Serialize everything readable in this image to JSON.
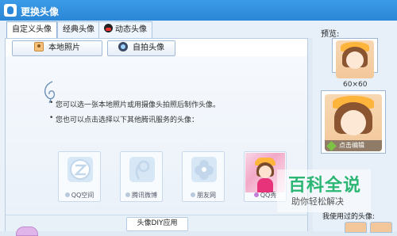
{
  "window": {
    "title": "更换头像"
  },
  "tabs": [
    {
      "label": "自定义头像"
    },
    {
      "label": "经典头像"
    },
    {
      "label": "动态头像"
    }
  ],
  "toolbar": {
    "local_photo": "本地照片",
    "selfie": "自拍头像"
  },
  "tips": [
    "您可以选一张本地照片或用摄像头拍照后制作头像。",
    "您也可以点击选择以下其他腾讯服务的头像："
  ],
  "services": [
    {
      "label": "QQ空间",
      "icon": "qzone-icon"
    },
    {
      "label": "腾讯微博",
      "icon": "tencent-weibo-icon"
    },
    {
      "label": "朋友网",
      "icon": "pengyou-icon"
    },
    {
      "label": "QQ秀",
      "icon": "qqshow-icon"
    }
  ],
  "bottom": {
    "diy_app": "头像DIY应用"
  },
  "preview": {
    "label": "预览:",
    "size_small": "60×60",
    "edit_label": "点击编辑",
    "used_label": "我使用过的头像:"
  },
  "watermark": {
    "main": "百科全说",
    "sub": "助你轻松解决"
  },
  "colors": {
    "titlebar": "#2a86d6",
    "watermark": "#2bb673"
  }
}
